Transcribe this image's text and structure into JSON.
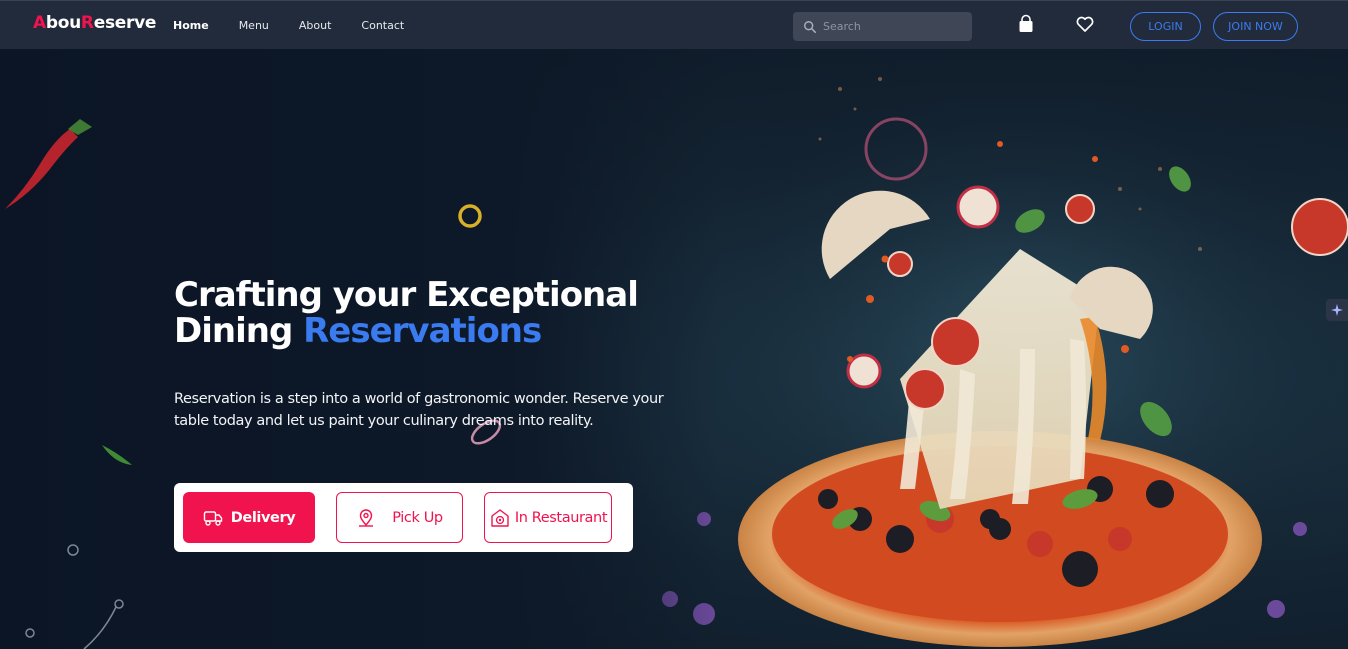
{
  "nav": {
    "logo_first_letter": "A",
    "logo_part1": "bou",
    "logo_second_letter": "R",
    "logo_part2": "eserve",
    "links": [
      "Home",
      "Menu",
      "About",
      "Contact"
    ],
    "search_placeholder": "Search",
    "login_label": "LOGIN",
    "join_label": "JOIN NOW",
    "icons": [
      "shopping-bag-icon",
      "heart-icon",
      "search-icon"
    ]
  },
  "hero": {
    "headline_line1": "Crafting your Exceptional",
    "headline_line2_prefix": "Dining ",
    "headline_line2_accent": "Reservations",
    "subtext": "Reservation is a step into a world of gastronomic wonder. Reserve your table today and let us paint your culinary dreams into reality.",
    "options": [
      {
        "label": "Delivery",
        "icon": "delivery-truck-icon"
      },
      {
        "label": "Pick Up",
        "icon": "location-pin-icon"
      },
      {
        "label": "In Restaurant",
        "icon": "restaurant-icon"
      }
    ]
  },
  "colors": {
    "accent_red": "#f0134d",
    "accent_blue": "#3b7bf0",
    "navbar_bg": "#222b3b",
    "hero_bg": "#0c1524"
  }
}
